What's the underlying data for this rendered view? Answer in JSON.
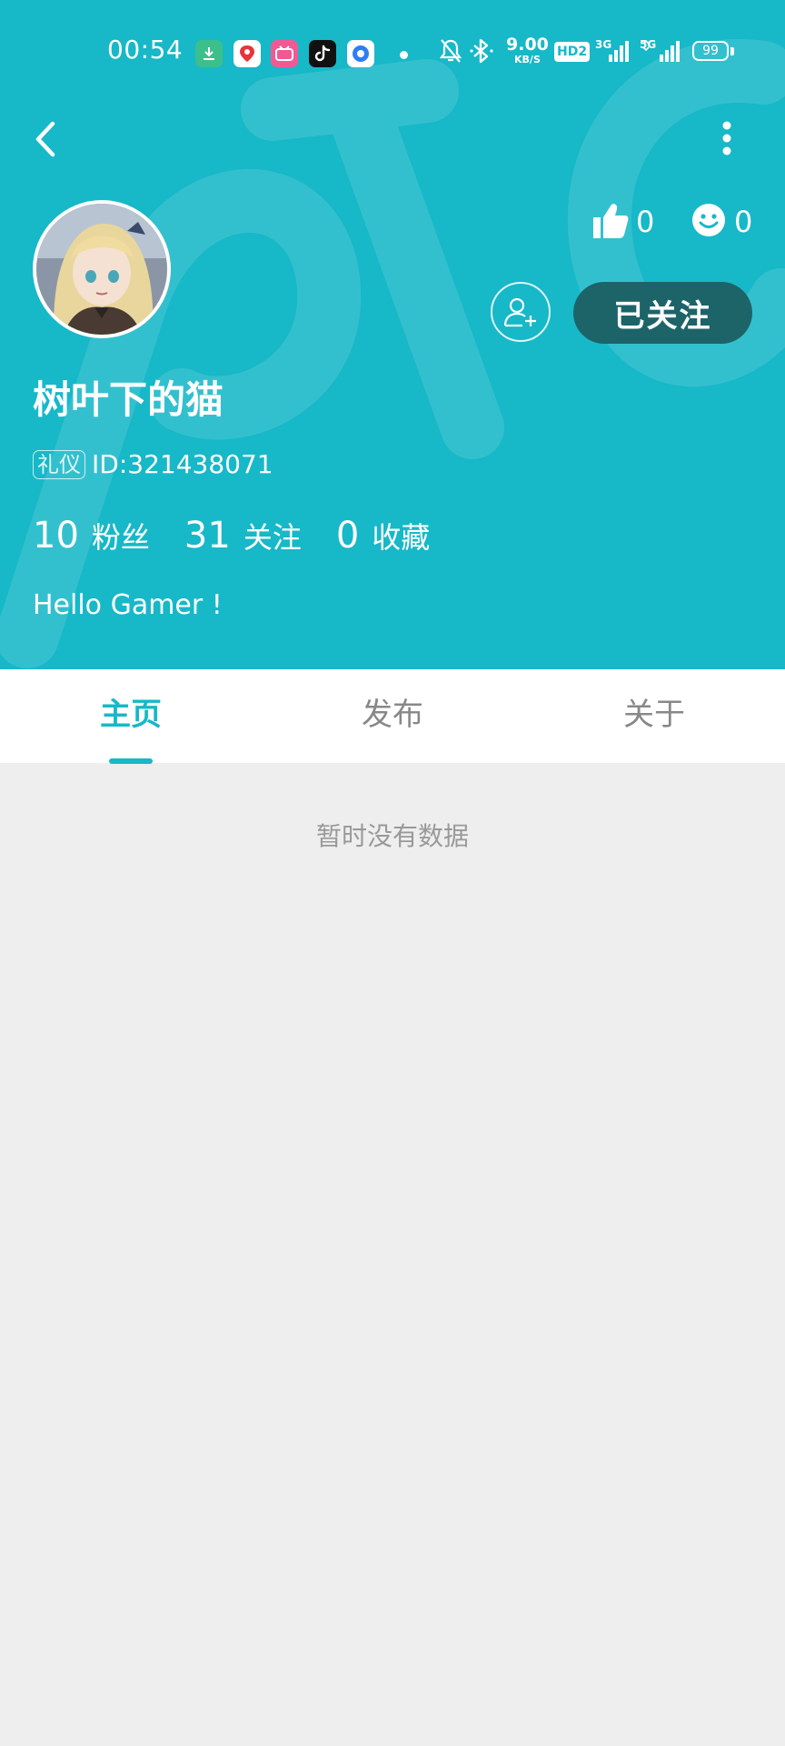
{
  "status_bar": {
    "time": "00:54",
    "network_speed": "9.00",
    "network_speed_unit": "KB/S",
    "hd_badge": "HD2",
    "signal_1": "3G",
    "signal_2": "5G",
    "battery": "99",
    "app_icons": [
      "download-app-icon",
      "map-app-icon",
      "bilibili-app-icon",
      "tiktok-app-icon",
      "browser-app-icon"
    ]
  },
  "colors": {
    "primary": "#17b8c8",
    "follow_button_bg": "#1d6469",
    "content_bg": "#eeeeee",
    "inactive_tab": "#888888"
  },
  "profile": {
    "likes_count": "0",
    "smiles_count": "0",
    "follow_button_label": "已关注",
    "username": "树叶下的猫",
    "tag": "礼仪",
    "user_id": "ID:321438071",
    "stats": [
      {
        "value": "10",
        "label": "粉丝"
      },
      {
        "value": "31",
        "label": "关注"
      },
      {
        "value": "0",
        "label": "收藏"
      }
    ],
    "bio": "Hello Gamer !"
  },
  "tabs": [
    {
      "label": "主页",
      "active": true
    },
    {
      "label": "发布",
      "active": false
    },
    {
      "label": "关于",
      "active": false
    }
  ],
  "main": {
    "empty_message": "暂时没有数据"
  }
}
